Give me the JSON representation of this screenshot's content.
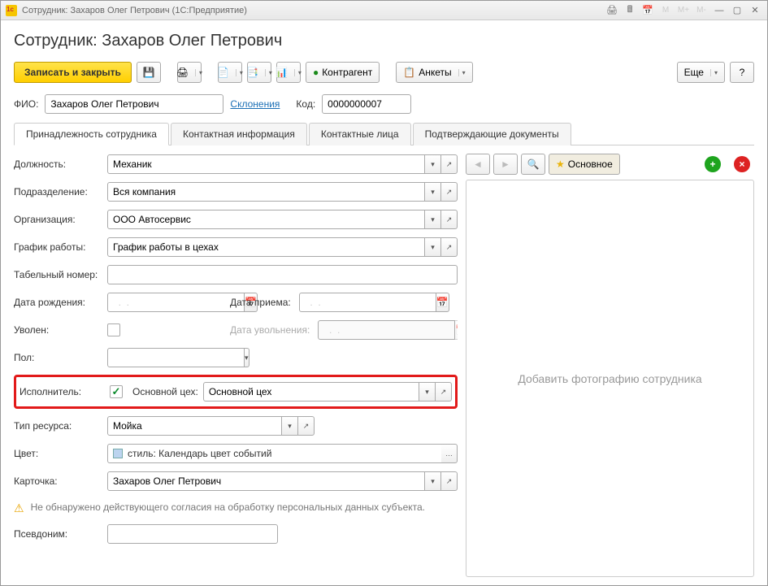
{
  "titlebar": {
    "text": "Сотрудник: Захаров Олег Петрович  (1С:Предприятие)"
  },
  "header": {
    "title": "Сотрудник: Захаров Олег Петрович"
  },
  "toolbar": {
    "primary": "Записать и закрыть",
    "counterparty": "Контрагент",
    "surveys": "Анкеты",
    "more": "Еще",
    "help": "?"
  },
  "fio": {
    "label": "ФИО:",
    "value": "Захаров Олег Петрович",
    "declensions": "Склонения"
  },
  "code": {
    "label": "Код:",
    "value": "0000000007"
  },
  "tabs": [
    "Принадлежность сотрудника",
    "Контактная информация",
    "Контактные лица",
    "Подтверждающие документы"
  ],
  "form": {
    "position_label": "Должность:",
    "position": "Механик",
    "department_label": "Подразделение:",
    "department": "Вся компания",
    "org_label": "Организация:",
    "org": "ООО Автосервис",
    "schedule_label": "График работы:",
    "schedule": "График работы в цехах",
    "tabnum_label": "Табельный номер:",
    "tabnum": "",
    "dob_label": "Дата рождения:",
    "dob": "  .  .    ",
    "hire_label": "Дата приема:",
    "hire": "  .  .    ",
    "fired_label": "Уволен:",
    "fire_date_label": "Дата увольнения:",
    "fire_date": "  .  .    ",
    "sex_label": "Пол:",
    "sex": "",
    "executor_label": "Исполнитель:",
    "main_shop_label": "Основной цех:",
    "main_shop": "Основной цех",
    "restype_label": "Тип ресурса:",
    "restype": "Мойка",
    "color_label": "Цвет:",
    "color": "стиль: Календарь цвет событий",
    "card_label": "Карточка:",
    "card": "Захаров Олег Петрович",
    "warning": "Не обнаружено действующего согласия на обработку персональных данных субъекта.",
    "alias_label": "Псевдоним:",
    "alias": ""
  },
  "photo": {
    "main_btn": "Основное",
    "placeholder": "Добавить фотографию сотрудника"
  }
}
